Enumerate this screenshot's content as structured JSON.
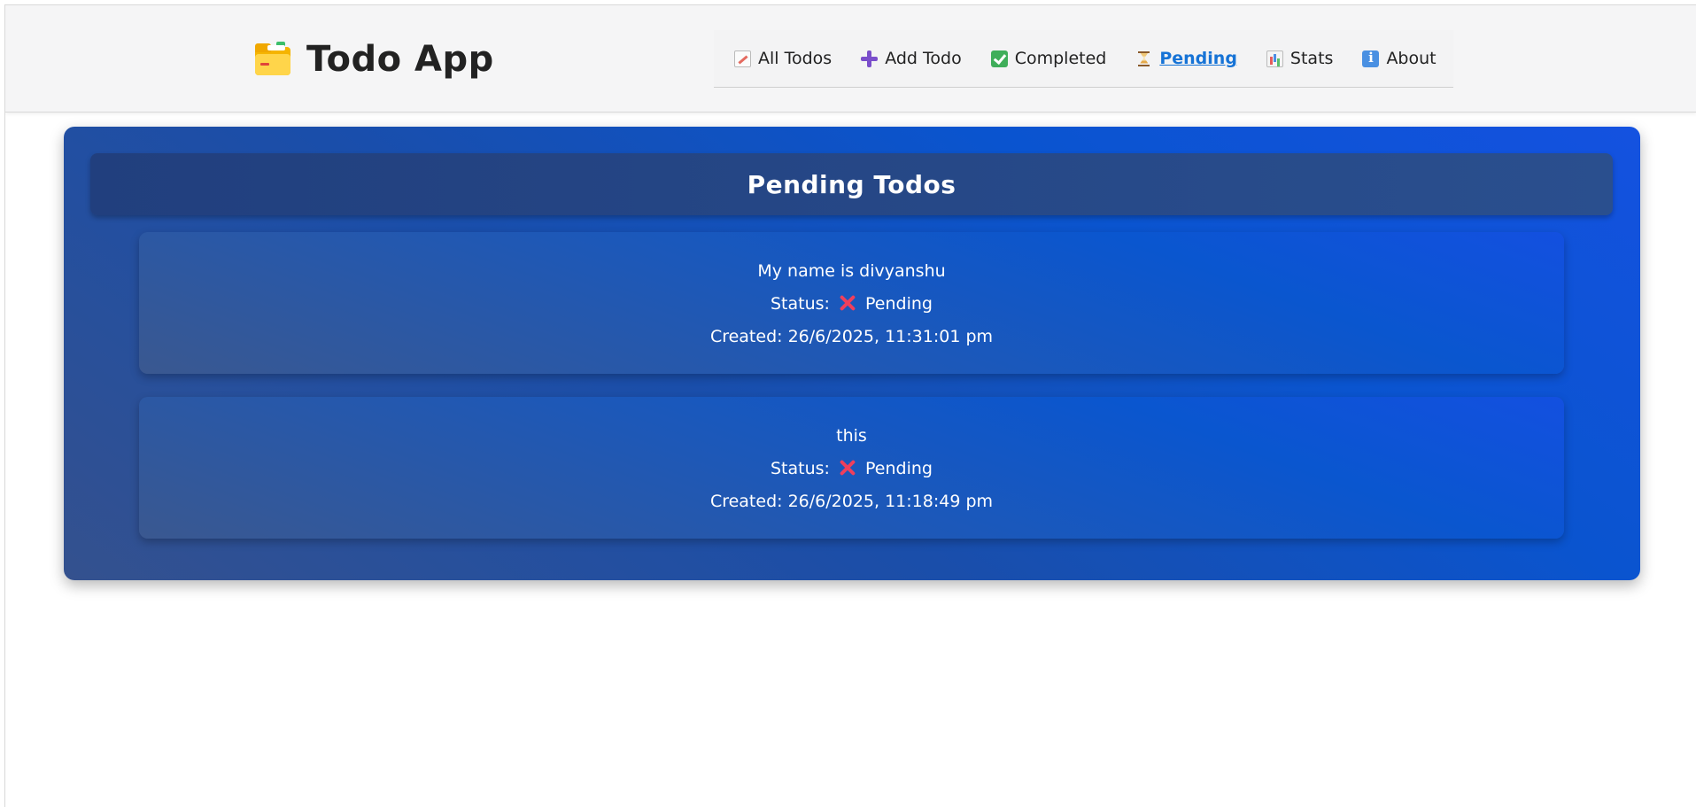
{
  "app": {
    "title": "Todo App",
    "logo_icon": "folder-icon"
  },
  "nav": {
    "items": [
      {
        "label": "All Todos",
        "icon": "memo-icon"
      },
      {
        "label": "Add Todo",
        "icon": "plus-icon"
      },
      {
        "label": "Completed",
        "icon": "check-icon"
      },
      {
        "label": "Pending",
        "icon": "hourglass-icon",
        "active": true
      },
      {
        "label": "Stats",
        "icon": "bar-chart-icon"
      },
      {
        "label": "About",
        "icon": "info-icon"
      }
    ],
    "active_color": "#1673d6"
  },
  "panel": {
    "title": "Pending Todos"
  },
  "todos": [
    {
      "text": "My name is divyanshu",
      "status_label": "Status:",
      "status_icon": "cross-mark-icon",
      "status_value": "Pending",
      "created_label": "Created:",
      "created_at": "26/6/2025, 11:31:01 pm"
    },
    {
      "text": "this",
      "status_label": "Status:",
      "status_icon": "cross-mark-icon",
      "status_value": "Pending",
      "created_label": "Created:",
      "created_at": "26/6/2025, 11:18:49 pm"
    }
  ],
  "colors": {
    "panel_blue": "#0a54cf",
    "header_bg": "#f5f5f6",
    "status_cross": "#ef3f5c"
  }
}
